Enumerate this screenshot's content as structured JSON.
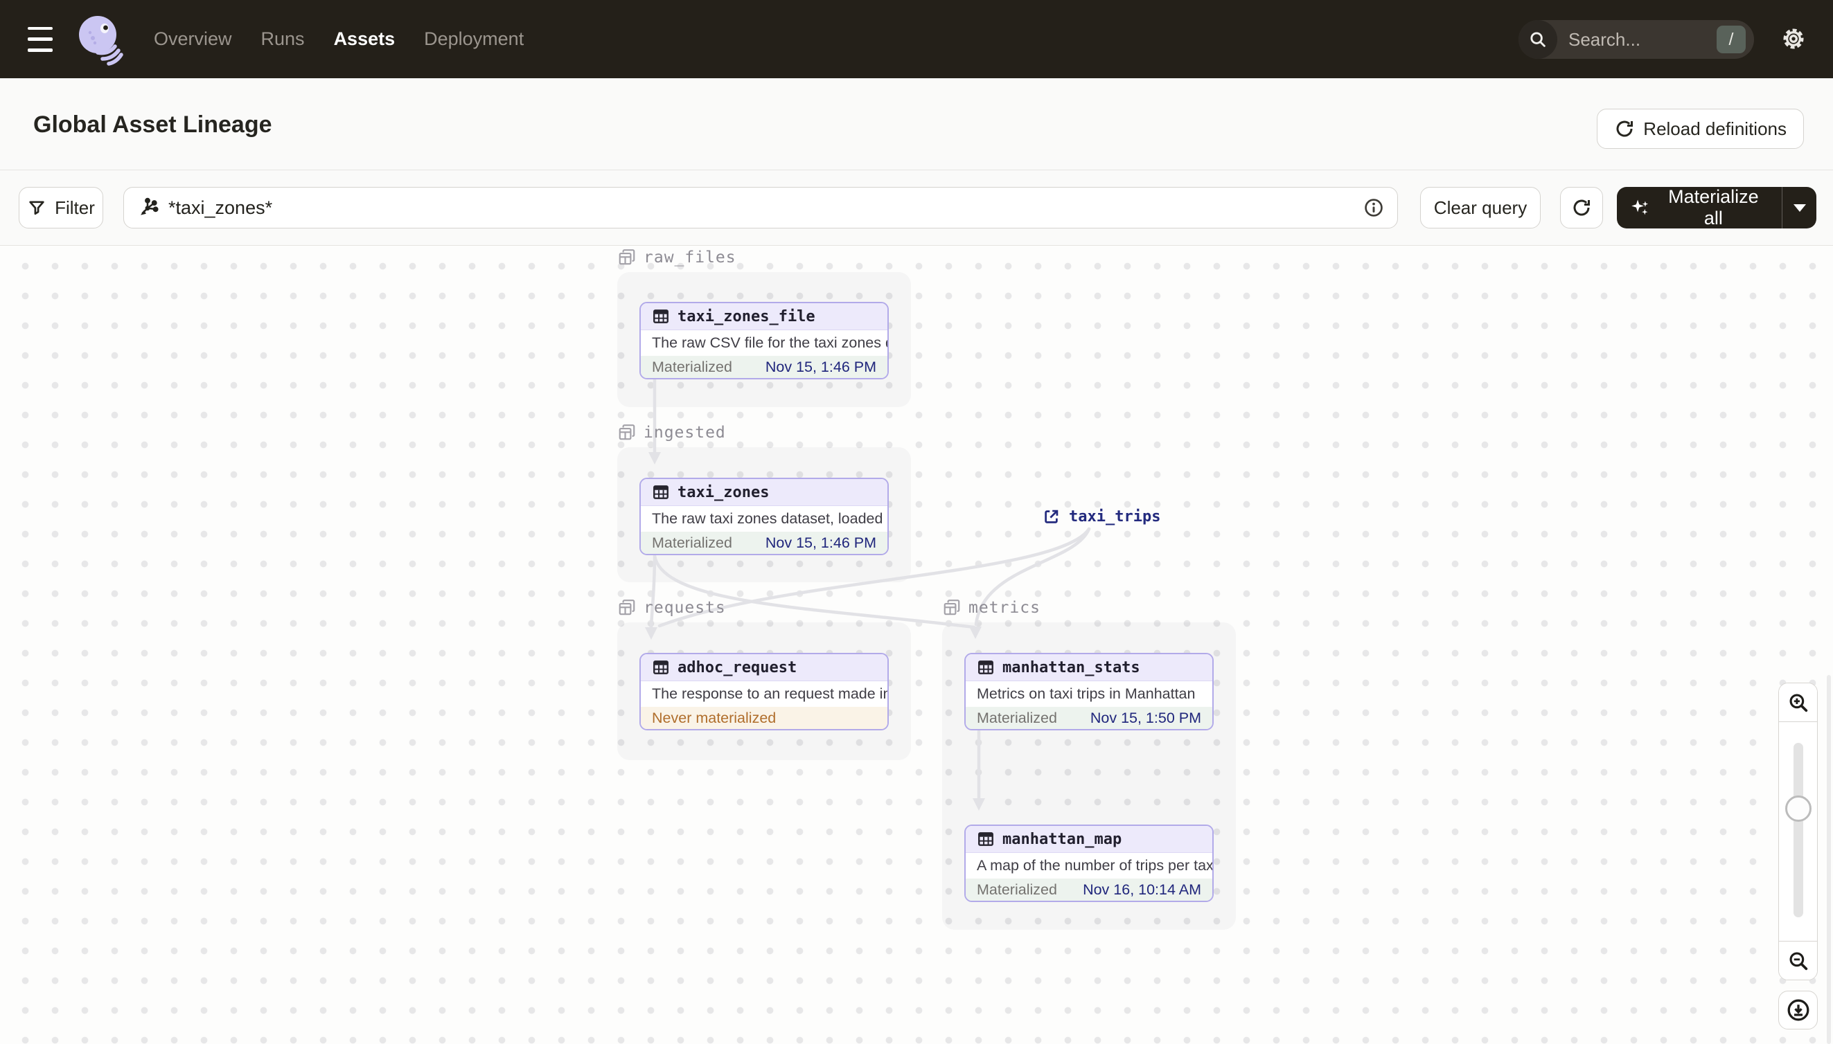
{
  "navbar": {
    "links": [
      {
        "label": "Overview",
        "active": false
      },
      {
        "label": "Runs",
        "active": false
      },
      {
        "label": "Assets",
        "active": true
      },
      {
        "label": "Deployment",
        "active": false
      }
    ],
    "search": {
      "placeholder": "Search...",
      "shortcut": "/"
    }
  },
  "header": {
    "title": "Global Asset Lineage",
    "reload_button": "Reload definitions"
  },
  "toolbar": {
    "filter_button": "Filter",
    "query_value": "*taxi_zones*",
    "clear_button": "Clear query",
    "materialize_button": "Materialize all"
  },
  "graph": {
    "groups": [
      {
        "name": "raw_files"
      },
      {
        "name": "ingested"
      },
      {
        "name": "requests"
      },
      {
        "name": "metrics"
      }
    ],
    "nodes": [
      {
        "id": "taxi_zones_file",
        "group": "raw_files",
        "title": "taxi_zones_file",
        "description": "The raw CSV file for the taxi zones dat...",
        "status": "Materialized",
        "timestamp": "Nov 15, 1:46 PM"
      },
      {
        "id": "taxi_zones",
        "group": "ingested",
        "title": "taxi_zones",
        "description": "The raw taxi zones dataset, loaded int...",
        "status": "Materialized",
        "timestamp": "Nov 15, 1:46 PM"
      },
      {
        "id": "adhoc_request",
        "group": "requests",
        "title": "adhoc_request",
        "description": "The response to an request made in th...",
        "status": "Never materialized",
        "timestamp": ""
      },
      {
        "id": "manhattan_stats",
        "group": "metrics",
        "title": "manhattan_stats",
        "description": "Metrics on taxi trips in Manhattan",
        "status": "Materialized",
        "timestamp": "Nov 15, 1:50 PM"
      },
      {
        "id": "manhattan_map",
        "group": "metrics",
        "title": "manhattan_map",
        "description": "A map of the number of trips per taxi z...",
        "status": "Materialized",
        "timestamp": "Nov 16, 10:14 AM"
      }
    ],
    "external_nodes": [
      {
        "title": "taxi_trips"
      }
    ],
    "edges": [
      {
        "from": "taxi_zones_file",
        "to": "taxi_zones"
      },
      {
        "from": "taxi_zones",
        "to": "adhoc_request"
      },
      {
        "from": "taxi_zones",
        "to": "manhattan_stats"
      },
      {
        "from": "taxi_trips",
        "to": "adhoc_request"
      },
      {
        "from": "taxi_trips",
        "to": "manhattan_stats"
      },
      {
        "from": "manhattan_stats",
        "to": "manhattan_map"
      }
    ]
  },
  "colors": {
    "navbar_bg": "#242019",
    "accent_lavender": "#b2aae9",
    "node_header_bg": "#edeafb",
    "materialized_bg": "#edf3ee",
    "never_materialized_bg": "#faf3e7",
    "never_materialized_text": "#b06e2c",
    "timestamp_text": "#20267c",
    "edge_color": "#e5e5e8"
  },
  "icons": {
    "menu": "hamburger",
    "logo": "dagster-octopus",
    "search": "magnifier",
    "settings": "gear",
    "reload": "refresh-arrow",
    "filter": "funnel",
    "query": "asset-graph",
    "info": "info-circle",
    "materialize": "sparkle",
    "group": "stacked-tables",
    "asset": "table-grid",
    "external": "external-link",
    "zoom_in": "magnifier-plus",
    "zoom_out": "magnifier-minus",
    "export": "download-circle"
  }
}
